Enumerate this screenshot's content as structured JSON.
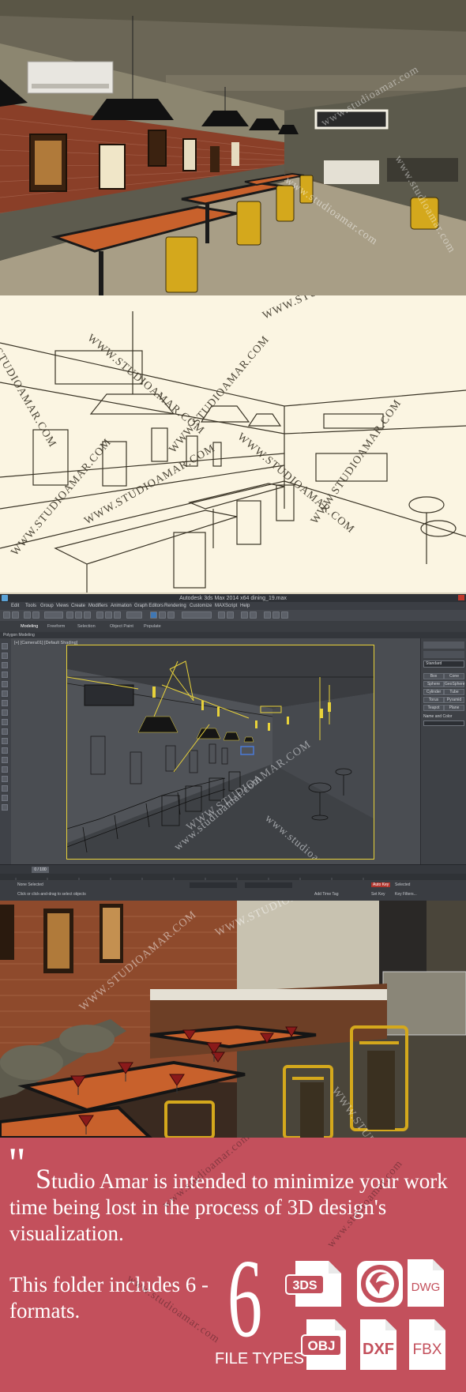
{
  "watermark": "www.studioamar.com",
  "watermark_caps": "WWW.STUDIOAMAR.COM",
  "max_ui": {
    "app_title": "Autodesk 3ds Max 2014 x64    dining_19.max",
    "menus": [
      "Edit",
      "Tools",
      "Group",
      "Views",
      "Create",
      "Modifiers",
      "Animation",
      "Graph Editors",
      "Rendering",
      "Customize",
      "MAXScript",
      "Help"
    ],
    "ribbon_label": "Polygon Modeling",
    "ribbon_tabs": [
      "Modeling",
      "Freeform",
      "Selection",
      "Object Paint",
      "Populate"
    ],
    "viewport_label": "[+] [Camera01] [Default Shading]",
    "timeline_counter": "0 / 100",
    "status_none_selected": "None Selected",
    "status_prompt": "Click or click-and-drag to select objects",
    "add_time_tag": "Add Time Tag",
    "auto_key": "Auto Key",
    "set_key": "Set Key",
    "selected": "Selected",
    "key_filters": "Key Filters...",
    "command_panel": {
      "dropdown": "Standard",
      "object_type_buttons": [
        "Box",
        "Cone",
        "Sphere",
        "GeoSphere",
        "Cylinder",
        "Tube",
        "Torus",
        "Pyramid",
        "Teapot",
        "Plane"
      ],
      "name_and_color": "Name and Color"
    }
  },
  "info": {
    "quote_mark": "\"",
    "tagline_first_letter": "S",
    "tagline_rest": "tudio Amar is intended to minimize your work time being lost in the process of 3D design's visualization.",
    "includes": "This folder includes 6 - formats.",
    "count": "6",
    "file_types_label": "FILE TYPES",
    "formats": [
      "3DS",
      "3ds Max logo",
      "DWG",
      "OBJ",
      "DXF",
      "FBX"
    ]
  },
  "colors": {
    "brand_panel": "#c3505c",
    "wireframe_accent": "#e8d23a",
    "max_ui_bg": "#44474d",
    "viewport_bg": "#5a5d62"
  }
}
